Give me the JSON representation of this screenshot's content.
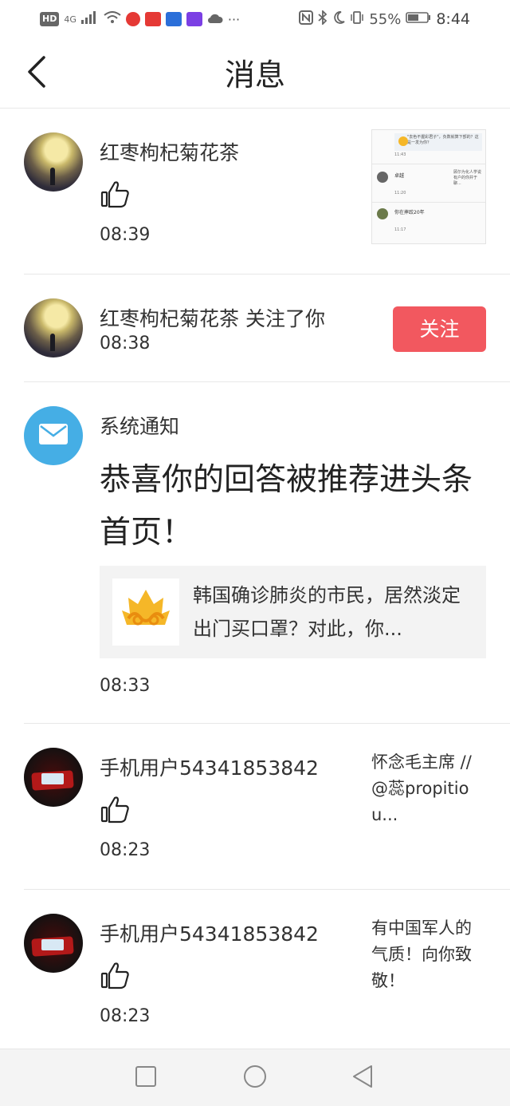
{
  "status_bar": {
    "left_chips": [
      "HD",
      "4G"
    ],
    "battery": "55%",
    "time": "8:44",
    "icons": [
      "nfc-icon",
      "bluetooth-icon",
      "moon-icon",
      "vibrate-icon",
      "battery-icon"
    ]
  },
  "header": {
    "title": "消息",
    "back_icon": "back-arrow-icon"
  },
  "messages": [
    {
      "type": "like",
      "user": "红枣枸杞菊花茶",
      "time": "08:39",
      "avatar": "moon-avatar",
      "thumbnail": {
        "quote": "\"去色不握彩君子\"，负数就算下部的？这是一发为你？",
        "rows": [
          {
            "name": "",
            "time": "11:43"
          },
          {
            "name": "卓越",
            "time": "11:20",
            "side": "顾尔为化人学说有户的你并于聊..."
          },
          {
            "name": "你在摔跤20年",
            "time": "11:17"
          }
        ]
      }
    },
    {
      "type": "follow",
      "user": "红枣枸杞菊花茶",
      "action": "关注了你",
      "time": "08:38",
      "avatar": "moon-avatar",
      "button": "关注"
    },
    {
      "type": "system",
      "user": "系统通知",
      "title": "恭喜你的回答被推荐进头条首页！",
      "news": "韩国确诊肺炎的市民，居然淡定出门买口罩？对此，你...",
      "time": "08:33",
      "avatar": "mail-icon"
    },
    {
      "type": "like",
      "user": "手机用户54341853842",
      "comment": "怀念毛主席 //@蕊propitiou...",
      "time": "08:23",
      "avatar": "dark-avatar"
    },
    {
      "type": "like",
      "user": "手机用户54341853842",
      "comment": "有中国军人的气质！向你致敬！",
      "time": "08:23",
      "avatar": "dark-avatar"
    }
  ],
  "nav": [
    "square-icon",
    "circle-icon",
    "triangle-back-icon"
  ],
  "colors": {
    "follow_button": "#f2585f",
    "mail_avatar": "#45aee5",
    "news_card_bg": "#f3f3f3"
  }
}
